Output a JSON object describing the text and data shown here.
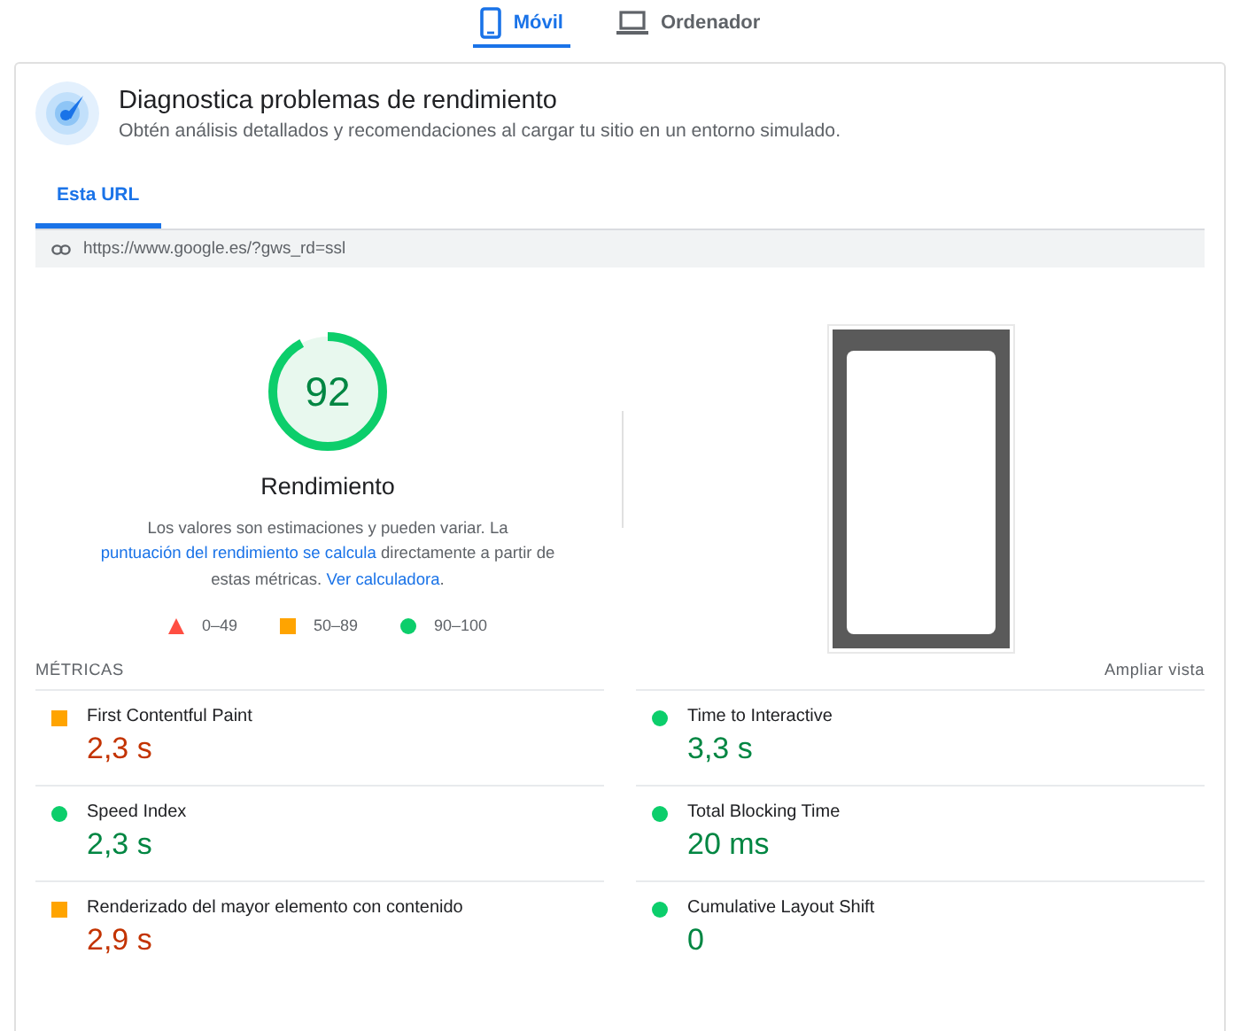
{
  "device_tabs": [
    {
      "label": "Móvil",
      "kind": "phone",
      "selected": true
    },
    {
      "label": "Ordenador",
      "kind": "laptop",
      "selected": false
    }
  ],
  "header": {
    "title": "Diagnostica problemas de rendimiento",
    "subtitle": "Obtén análisis detallados y recomendaciones al cargar tu sitio en un entorno simulado."
  },
  "url_tabs": [
    {
      "label": "Esta URL",
      "selected": true
    }
  ],
  "url": "https://www.google.es/?gws_rd=ssl",
  "score": {
    "value": "92",
    "level": 0.92,
    "label": "Rendimiento",
    "description": "Los valores son estimaciones y pueden variar. La ",
    "links": [
      "puntuación del rendimiento se calcula",
      "Ver calculadora"
    ],
    "middle": " directamente a partir de estas métricas. ",
    "end": "."
  },
  "legend": [
    {
      "kind": "fail",
      "label": "0–49"
    },
    {
      "kind": "average",
      "label": "50–89"
    },
    {
      "kind": "pass",
      "label": "90–100"
    }
  ],
  "metrics_title": "MÉTRICAS",
  "expand_link": "Ampliar vista",
  "metrics": [
    {
      "name": "First Contentful Paint",
      "value": "2,3 s",
      "kind": "average"
    },
    {
      "name": "Time to Interactive",
      "value": "3,3 s",
      "kind": "pass"
    },
    {
      "name": "Speed Index",
      "value": "2,3 s",
      "kind": "pass"
    },
    {
      "name": "Total Blocking Time",
      "value": "20 ms",
      "kind": "pass"
    },
    {
      "name": "Renderizado del mayor elemento con contenido",
      "value": "2,9 s",
      "kind": "average"
    },
    {
      "name": "Cumulative Layout Shift",
      "value": "0",
      "kind": "pass"
    }
  ]
}
